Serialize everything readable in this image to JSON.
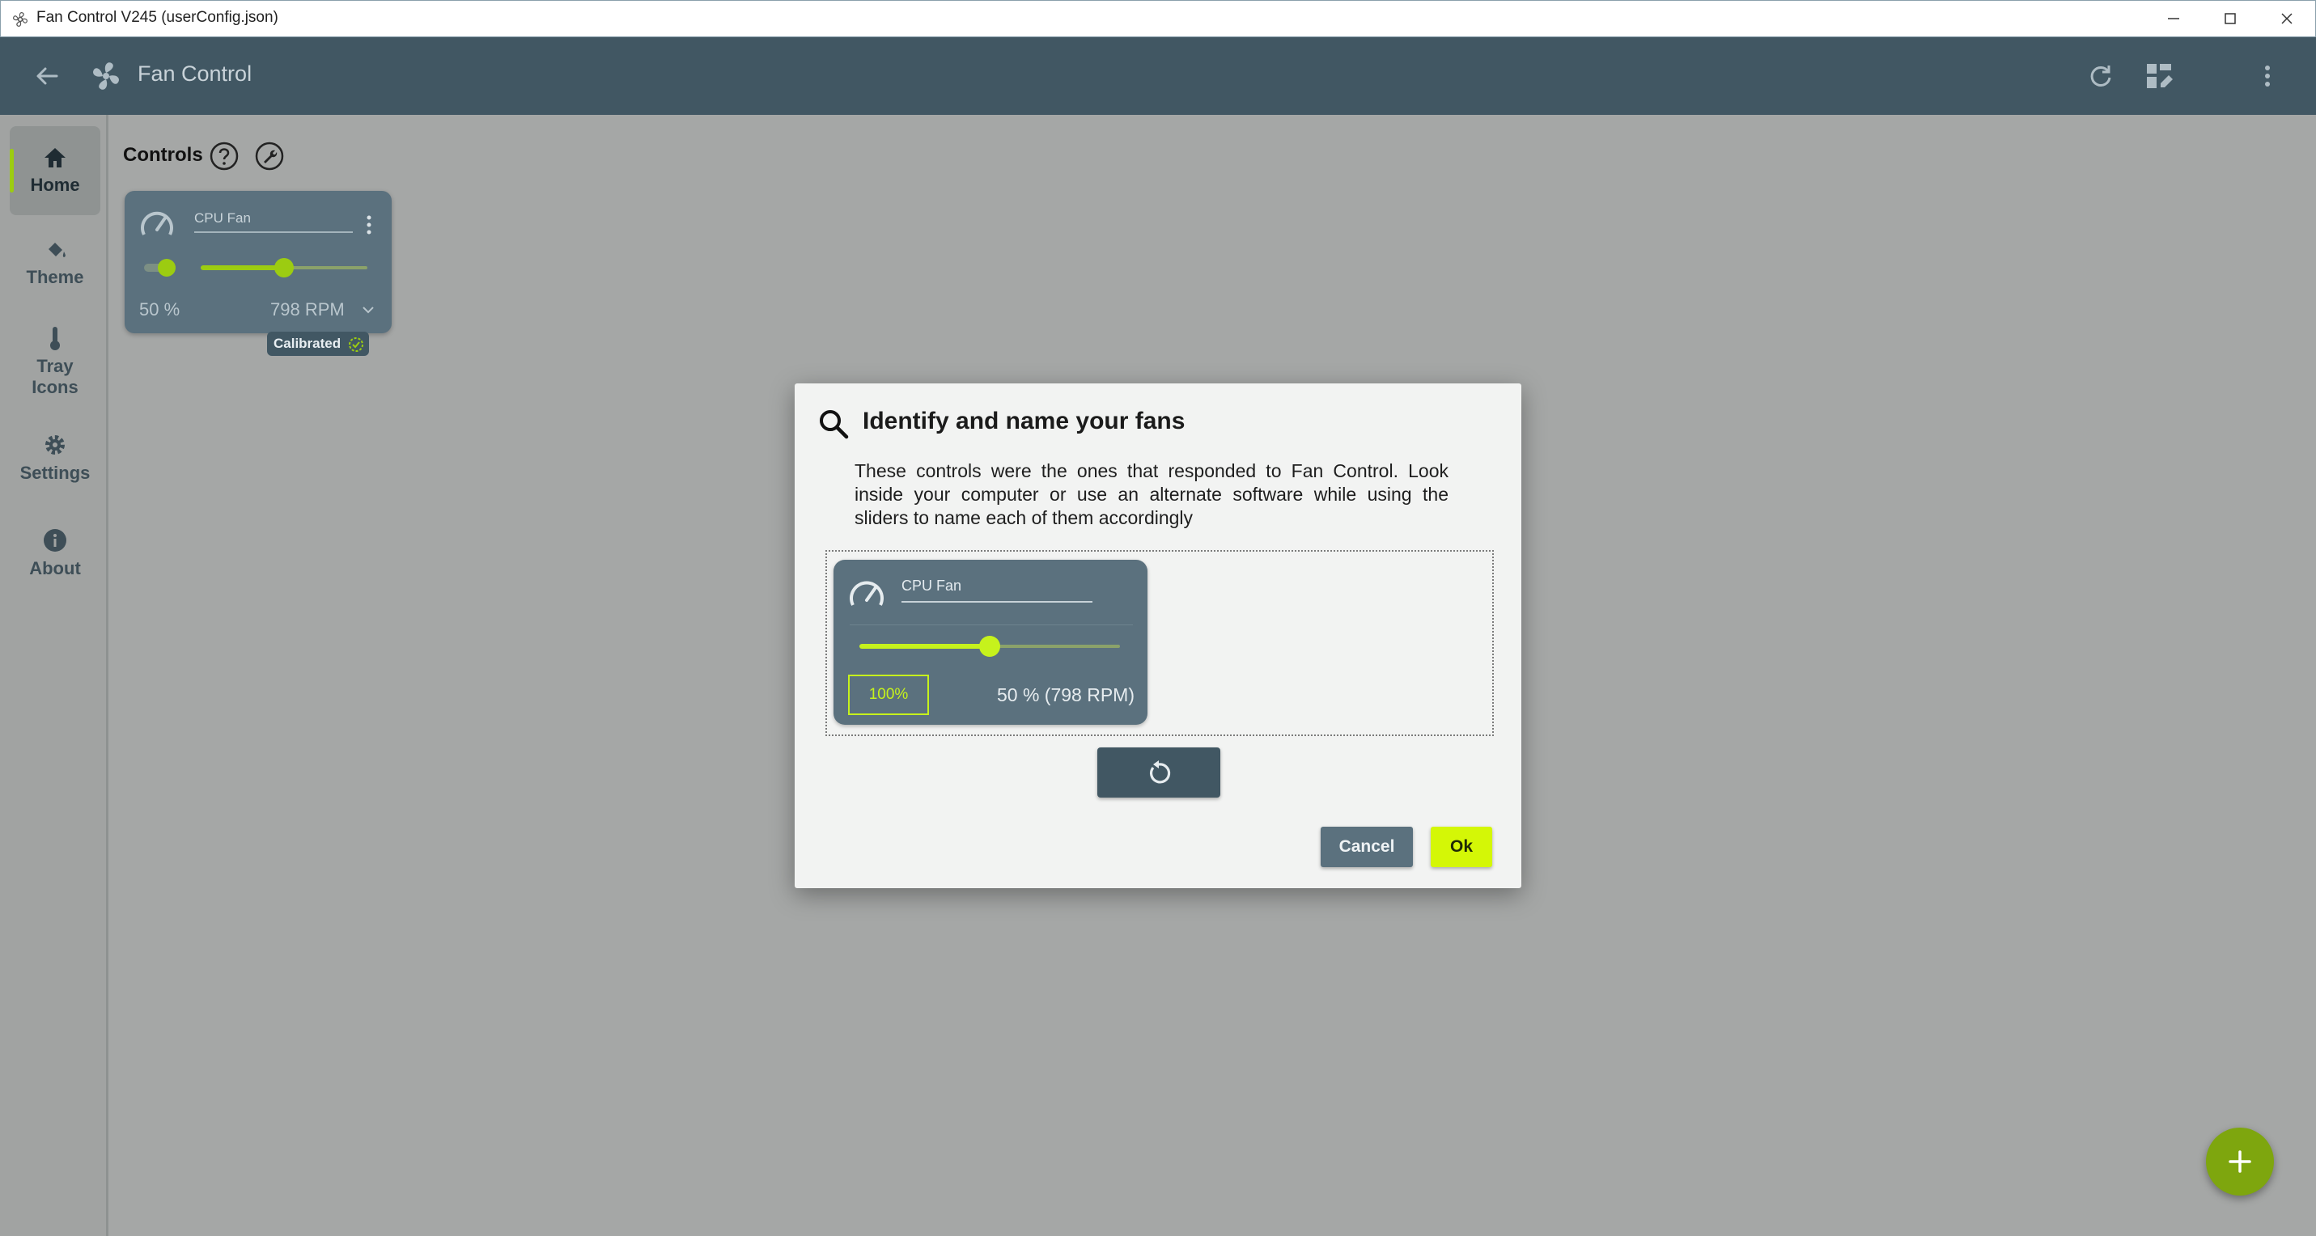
{
  "window": {
    "title": "Fan Control V245 (userConfig.json)"
  },
  "header": {
    "title": "Fan Control"
  },
  "sidebar": {
    "items": [
      {
        "label": "Home"
      },
      {
        "label": "Theme"
      },
      {
        "label": "Tray Icons"
      },
      {
        "label": "Settings"
      },
      {
        "label": "About"
      }
    ]
  },
  "controls": {
    "title": "Controls",
    "card": {
      "name": "CPU Fan",
      "percent_label": "50 %",
      "rpm_label": "798 RPM",
      "badge": "Calibrated",
      "slider_value": 0.5
    }
  },
  "dialog": {
    "title": "Identify and name your fans",
    "description": "These controls were the ones that responded to Fan Control. Look inside your computer or use an alternate software while using the sliders to name each of them accordingly",
    "card": {
      "name": "CPU Fan",
      "button_label": "100%",
      "status": "50 %  (798 RPM)",
      "slider_value": 0.5
    },
    "cancel_label": "Cancel",
    "ok_label": "Ok"
  },
  "colors": {
    "header": "#415763",
    "card": "#5b717e",
    "accent": "#c6f21c",
    "ok_button": "#d4f706",
    "fab": "#7ea60e"
  }
}
